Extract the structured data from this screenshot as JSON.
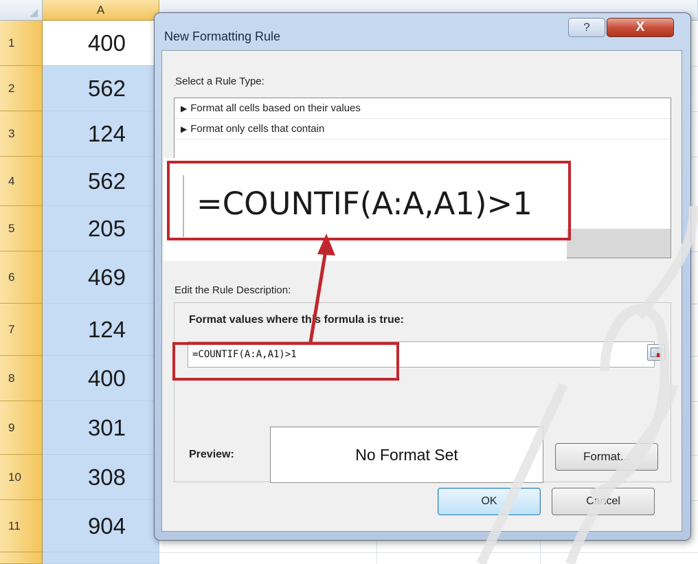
{
  "sheet": {
    "column_header": "A",
    "rows": [
      {
        "num": "1",
        "value": "400"
      },
      {
        "num": "2",
        "value": "562"
      },
      {
        "num": "3",
        "value": "124"
      },
      {
        "num": "4",
        "value": "562"
      },
      {
        "num": "5",
        "value": "205"
      },
      {
        "num": "6",
        "value": "469"
      },
      {
        "num": "7",
        "value": "124"
      },
      {
        "num": "8",
        "value": "400"
      },
      {
        "num": "9",
        "value": "301"
      },
      {
        "num": "10",
        "value": "308"
      },
      {
        "num": "11",
        "value": "904"
      }
    ]
  },
  "dialog": {
    "title": "New Formatting Rule",
    "help_label": "?",
    "close_label": "X",
    "select_rule_type_label": "Select a Rule Type:",
    "rule_types": [
      "Format all cells based on their values",
      "Format only cells that contain"
    ],
    "edit_description_label": "Edit the Rule Description:",
    "formula_label": "Format values where this formula is true:",
    "formula_value": "=COUNTIF(A:A,A1)>1",
    "preview_label": "Preview:",
    "preview_text": "No Format Set",
    "format_button": "Format...",
    "ok_button": "OK",
    "cancel_button": "Cancel"
  },
  "callout": {
    "zoomed_formula": "=COUNTIF(A:A,A1)>1"
  },
  "colors": {
    "highlight_cell": "#c6dcf5",
    "callout_red": "#c0272d",
    "header_gold": "#f3c55c"
  }
}
